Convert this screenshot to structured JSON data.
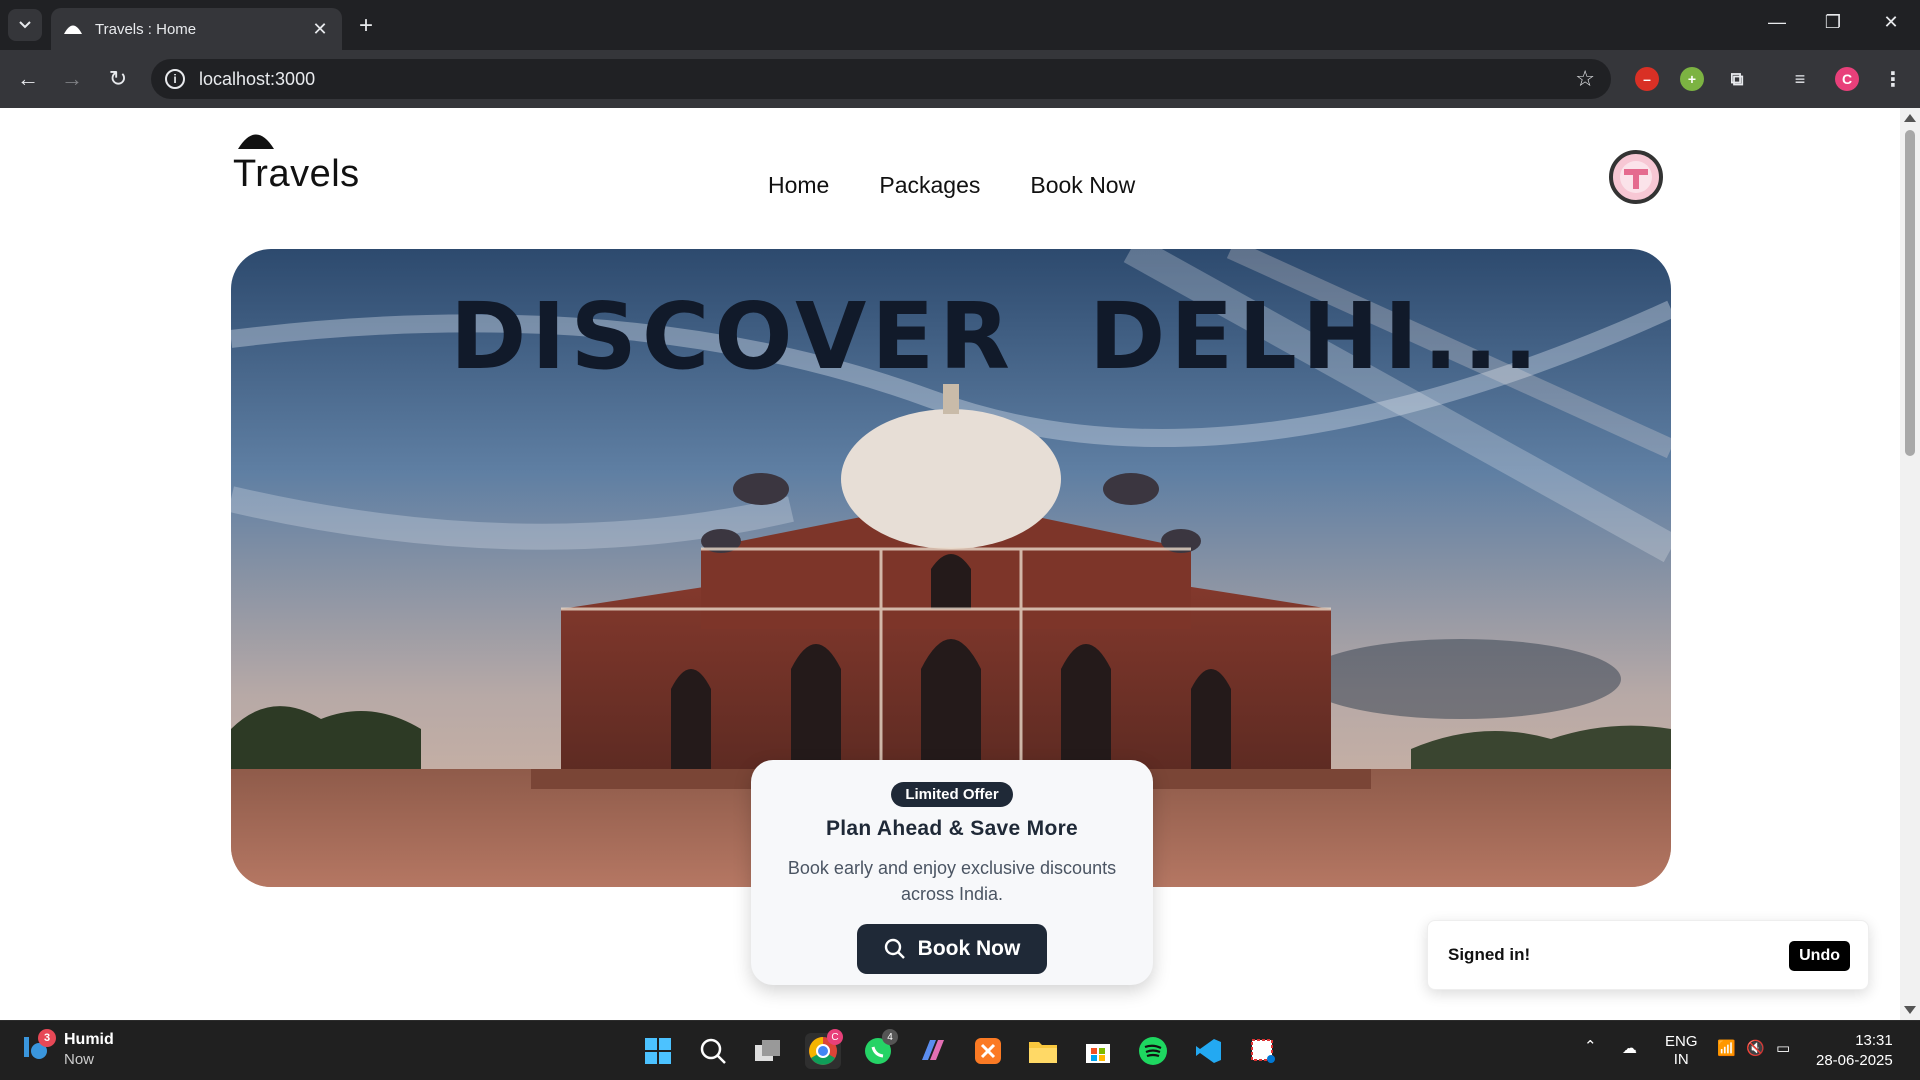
{
  "browser": {
    "tab_title": "Travels : Home",
    "url": "localhost:3000",
    "new_tab": "+",
    "profile_initial": "C"
  },
  "site": {
    "brand": "Travels",
    "nav": [
      "Home",
      "Packages",
      "Book Now"
    ]
  },
  "hero": {
    "title": "DISCOVER  DELHI..."
  },
  "offer": {
    "badge": "Limited Offer",
    "heading": "Plan Ahead & Save More",
    "description": "Book early and enjoy exclusive discounts across India.",
    "cta": "Book Now"
  },
  "toast": {
    "message": "Signed in!",
    "action": "Undo"
  },
  "taskbar": {
    "weather_title": "Humid",
    "weather_sub": "Now",
    "weather_badge": "3",
    "whatsapp_badge": "4",
    "chrome_badge": "C",
    "lang_1": "ENG",
    "lang_2": "IN",
    "time": "13:31",
    "date": "28-06-2025"
  },
  "colors": {
    "primary_dark": "#1f2937",
    "brand_text": "#111111"
  }
}
